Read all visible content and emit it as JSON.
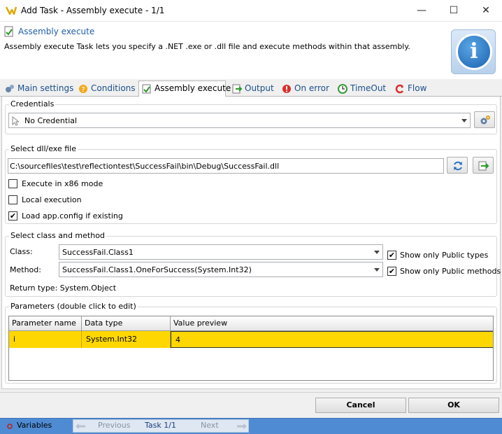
{
  "window": {
    "title": "Add Task - Assembly execute - 1/1",
    "minimize_glyph": "—",
    "maximize_glyph": "☐",
    "close_glyph": "✕"
  },
  "header": {
    "title": "Assembly execute",
    "description": "Assembly execute Task lets you specify a .NET .exe or .dll file and execute methods within that assembly.",
    "info_glyph": "i"
  },
  "tabs": [
    {
      "label": "Main settings",
      "icon": "gears-icon"
    },
    {
      "label": "Conditions",
      "icon": "conditions-icon"
    },
    {
      "label": "Assembly execute",
      "icon": "assembly-icon"
    },
    {
      "label": "Output",
      "icon": "output-icon"
    },
    {
      "label": "On error",
      "icon": "error-icon"
    },
    {
      "label": "TimeOut",
      "icon": "timeout-icon"
    },
    {
      "label": "Flow",
      "icon": "flow-icon"
    }
  ],
  "credentials": {
    "group_label": "Credentials",
    "value": "No Credential"
  },
  "file": {
    "group_label": "Select dll/exe file",
    "path": "C:\\sourcefiles\\test\\reflectiontest\\SuccessFail\\bin\\Debug\\SuccessFail.dll",
    "x86_label": "Execute in x86 mode",
    "x86_checked": false,
    "local_label": "Local execution",
    "local_checked": false,
    "appconfig_label": "Load app.config if existing",
    "appconfig_checked": true
  },
  "class_method": {
    "group_label": "Select class and method",
    "class_label": "Class:",
    "class_value": "SuccessFail.Class1",
    "method_label": "Method:",
    "method_value": "SuccessFail.Class1.OneForSuccess(System.Int32)",
    "public_types_label": "Show only Public types",
    "public_types_checked": true,
    "public_methods_label": "Show only Public methods",
    "public_methods_checked": true,
    "return_type": "Return type: System.Object"
  },
  "parameters": {
    "group_label": "Parameters (double click to edit)",
    "columns": [
      "Parameter name",
      "Data type",
      "Value preview"
    ],
    "rows": [
      {
        "name": "i",
        "type": "System.Int32",
        "value": "4"
      }
    ]
  },
  "buttons": {
    "cancel": "Cancel",
    "ok": "OK"
  },
  "statusbar": {
    "variables": "Variables",
    "previous": "Previous",
    "task": "Task 1/1",
    "next": "Next"
  },
  "colors": {
    "selected_row": "#ffd700",
    "header_title": "#1f5fa8",
    "statusbar": "#4f8bd3"
  }
}
